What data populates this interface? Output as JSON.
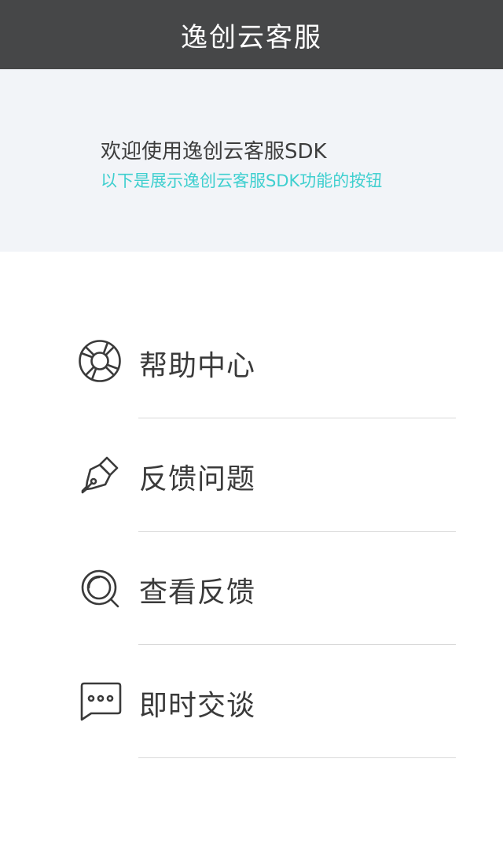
{
  "navbar": {
    "title": "逸创云客服"
  },
  "banner": {
    "title": "欢迎使用逸创云客服SDK",
    "subtitle": "以下是展示逸创云客服SDK功能的按钮"
  },
  "menu": {
    "items": [
      {
        "label": "帮助中心",
        "icon": "lifebuoy-icon"
      },
      {
        "label": "反馈问题",
        "icon": "pen-nib-icon"
      },
      {
        "label": "查看反馈",
        "icon": "search-icon"
      },
      {
        "label": "即时交谈",
        "icon": "chat-bubble-icon"
      }
    ]
  },
  "colors": {
    "navbar_bg": "#464748",
    "banner_bg": "#f2f4f8",
    "accent": "#3fcfcf",
    "text": "#3a3a3a",
    "divider": "#d9d9d9"
  }
}
